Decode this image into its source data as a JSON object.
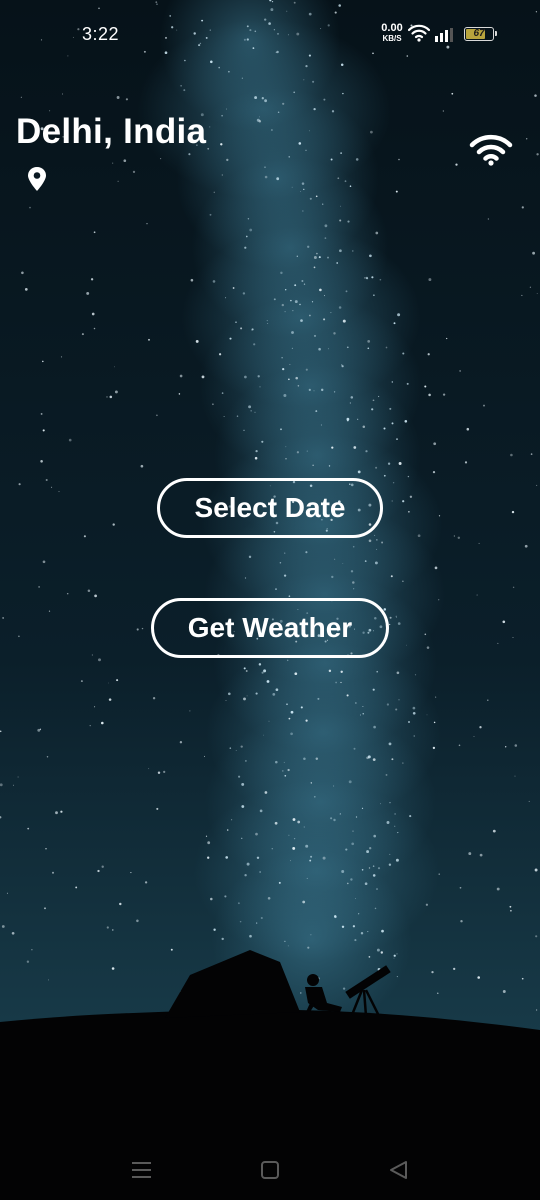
{
  "status_bar": {
    "time": "3:22",
    "net_speed_value": "0.00",
    "net_speed_unit": "KB/S",
    "battery_level": "67"
  },
  "header": {
    "location": "Delhi, India"
  },
  "actions": {
    "select_date_label": "Select Date",
    "get_weather_label": "Get Weather"
  },
  "icons": {
    "location": "map-pin-icon",
    "connection": "wifi-icon"
  },
  "colors": {
    "sky_dark": "#06121a",
    "sky_mid": "#143341",
    "ground": "#030304",
    "text": "#ffffff",
    "battery_fill": "#b7a43d"
  }
}
